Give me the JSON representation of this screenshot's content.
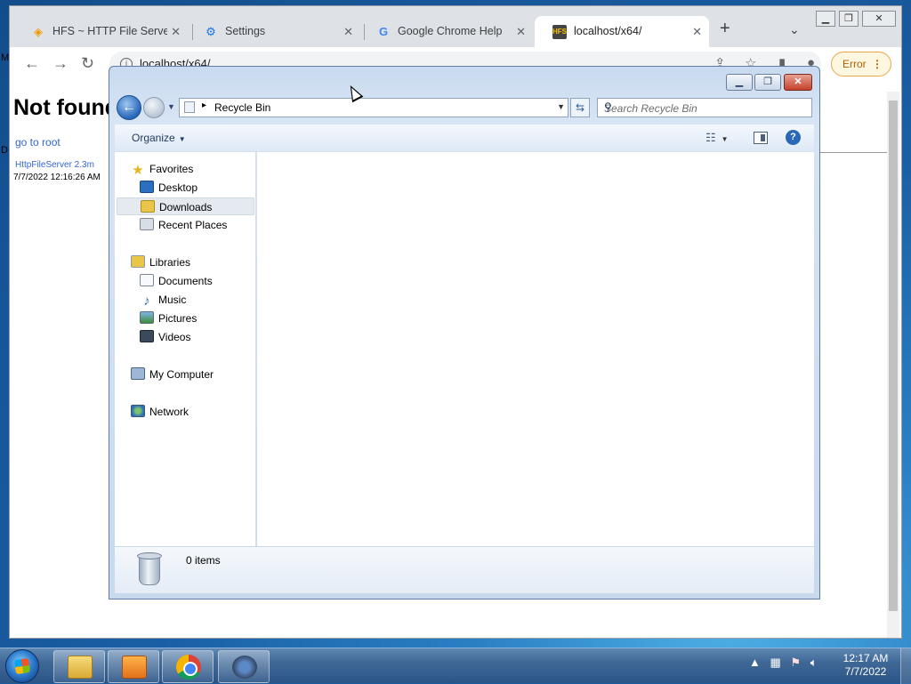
{
  "browser": {
    "tabs": [
      {
        "title": "HFS ~ HTTP File Server",
        "icon": "hfs-diamond-icon"
      },
      {
        "title": "Settings",
        "icon": "gear-icon"
      },
      {
        "title": "Google Chrome Help",
        "icon": "google-g-icon"
      },
      {
        "title": "localhost/x64/",
        "icon": "hfs-favicon"
      }
    ],
    "url": "localhost/x64/",
    "error_label": "Error",
    "accent_color": "#f29900"
  },
  "page": {
    "heading": "Not found",
    "link": "go to root",
    "server_version": "HttpFileServer 2.3m",
    "timestamp": "7/7/2022 12:16:26 AM",
    "edge_letters": [
      "M",
      "D"
    ]
  },
  "explorer": {
    "location": "Recycle Bin",
    "search_placeholder": "Search Recycle Bin",
    "organize_label": "Organize",
    "favorites_header": "Favorites",
    "favorites": [
      "Desktop",
      "Downloads",
      "Recent Places"
    ],
    "selected_item": "Downloads",
    "libraries_header": "Libraries",
    "libraries": [
      "Documents",
      "Music",
      "Pictures",
      "Videos"
    ],
    "computer_label": "My Computer",
    "network_label": "Network",
    "item_count": "0 items"
  },
  "taskbar": {
    "apps": [
      "windows-explorer",
      "media-player",
      "google-chrome",
      "hfs-server"
    ],
    "time": "12:17 AM",
    "date": "7/7/2022"
  }
}
